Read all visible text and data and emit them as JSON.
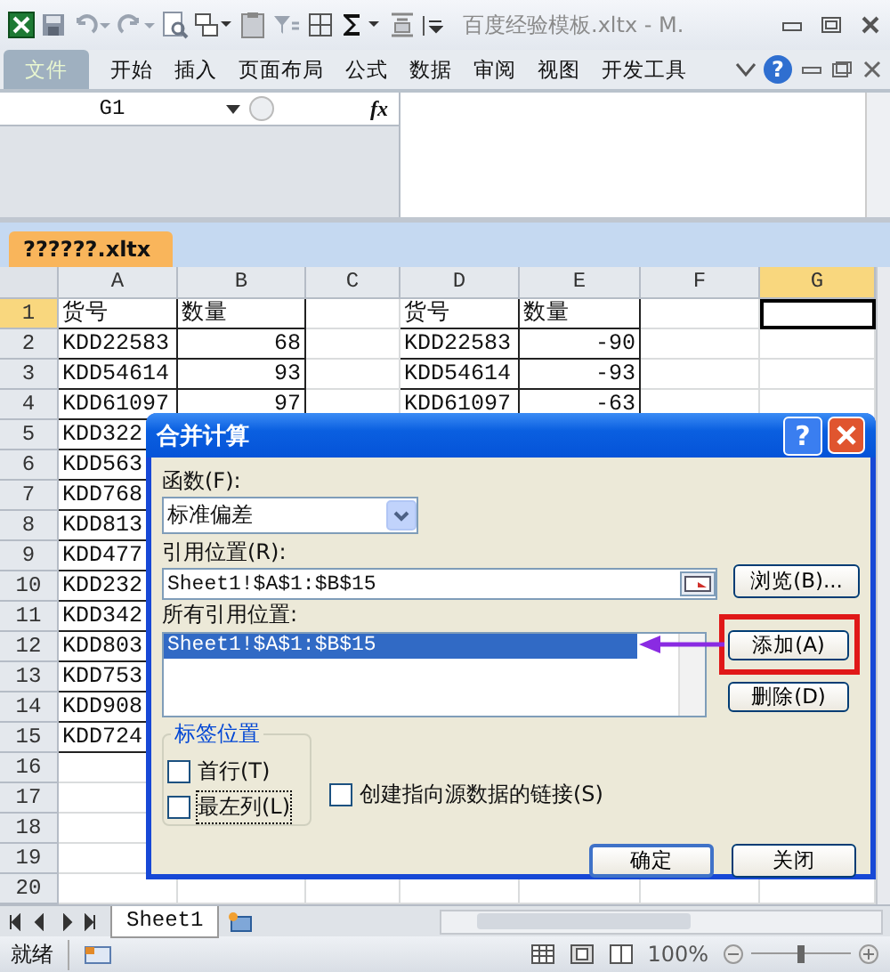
{
  "title_bar": {
    "title": "百度经验模板.xltx - M."
  },
  "ribbon_tabs": [
    {
      "label": "文件",
      "selected": true
    },
    {
      "label": "开始",
      "selected": false
    },
    {
      "label": "插入",
      "selected": false
    },
    {
      "label": "页面布局",
      "selected": false
    },
    {
      "label": "公式",
      "selected": false
    },
    {
      "label": "数据",
      "selected": false
    },
    {
      "label": "审阅",
      "selected": false
    },
    {
      "label": "视图",
      "selected": false
    },
    {
      "label": "开发工具",
      "selected": false
    }
  ],
  "help_glyph": "?",
  "formula_bar": {
    "name_box": "G1",
    "fx": "fx"
  },
  "workbook_tab": "??????.xltx",
  "sheet": {
    "columns": [
      {
        "label": "A",
        "selected": false
      },
      {
        "label": "B",
        "selected": false
      },
      {
        "label": "C",
        "selected": false
      },
      {
        "label": "D",
        "selected": false
      },
      {
        "label": "E",
        "selected": false
      },
      {
        "label": "F",
        "selected": false
      },
      {
        "label": "G",
        "selected": true
      }
    ],
    "rows": [
      {
        "label": "1",
        "selected": true,
        "cells": [
          {
            "kind": "text",
            "value": "货号"
          },
          {
            "kind": "text",
            "value": "数量"
          },
          {
            "kind": "blank"
          },
          {
            "kind": "text",
            "value": "货号"
          },
          {
            "kind": "text",
            "value": "数量"
          },
          {
            "kind": "blank"
          },
          {
            "kind": "blank",
            "active": true
          }
        ]
      },
      {
        "label": "2",
        "selected": false,
        "cells": [
          {
            "kind": "text",
            "value": "KDD22583"
          },
          {
            "kind": "number",
            "value": "68"
          },
          {
            "kind": "blank"
          },
          {
            "kind": "text",
            "value": "KDD22583"
          },
          {
            "kind": "number",
            "value": "-90"
          }
        ]
      },
      {
        "label": "3",
        "selected": false,
        "cells": [
          {
            "kind": "text",
            "value": "KDD54614"
          },
          {
            "kind": "number",
            "value": "93"
          },
          {
            "kind": "blank"
          },
          {
            "kind": "text",
            "value": "KDD54614"
          },
          {
            "kind": "number",
            "value": "-93"
          }
        ]
      },
      {
        "label": "4",
        "selected": false,
        "cells": [
          {
            "kind": "text",
            "value": "KDD61097"
          },
          {
            "kind": "number",
            "value": "97"
          },
          {
            "kind": "blank"
          },
          {
            "kind": "text",
            "value": "KDD61097"
          },
          {
            "kind": "number",
            "value": "-63"
          }
        ]
      },
      {
        "label": "5",
        "selected": false,
        "cells": [
          {
            "kind": "text",
            "value": "KDD322"
          }
        ]
      },
      {
        "label": "6",
        "selected": false,
        "cells": [
          {
            "kind": "text",
            "value": "KDD563"
          }
        ]
      },
      {
        "label": "7",
        "selected": false,
        "cells": [
          {
            "kind": "text",
            "value": "KDD768"
          }
        ]
      },
      {
        "label": "8",
        "selected": false,
        "cells": [
          {
            "kind": "text",
            "value": "KDD813"
          }
        ]
      },
      {
        "label": "9",
        "selected": false,
        "cells": [
          {
            "kind": "text",
            "value": "KDD477"
          }
        ]
      },
      {
        "label": "10",
        "selected": false,
        "cells": [
          {
            "kind": "text",
            "value": "KDD232"
          }
        ]
      },
      {
        "label": "11",
        "selected": false,
        "cells": [
          {
            "kind": "text",
            "value": "KDD342"
          }
        ]
      },
      {
        "label": "12",
        "selected": false,
        "cells": [
          {
            "kind": "text",
            "value": "KDD803"
          }
        ]
      },
      {
        "label": "13",
        "selected": false,
        "cells": [
          {
            "kind": "text",
            "value": "KDD753"
          }
        ]
      },
      {
        "label": "14",
        "selected": false,
        "cells": [
          {
            "kind": "text",
            "value": "KDD908"
          }
        ]
      },
      {
        "label": "15",
        "selected": false,
        "cells": [
          {
            "kind": "text",
            "value": "KDD724"
          }
        ]
      },
      {
        "label": "16",
        "selected": false
      },
      {
        "label": "17",
        "selected": false
      },
      {
        "label": "18",
        "selected": false
      },
      {
        "label": "19",
        "selected": false
      },
      {
        "label": "20",
        "selected": false
      }
    ]
  },
  "sheet_tabs": [
    {
      "label": "Sheet1",
      "selected": true
    }
  ],
  "status_bar": {
    "status": "就绪",
    "zoom": "100%",
    "zoom_slider": {
      "level": 0.5
    }
  },
  "dialog": {
    "title": "合并计算",
    "help_glyph": "?",
    "function_label": "函数(F):",
    "function_value": "标准偏差",
    "reference_label": "引用位置(R):",
    "reference_value": "Sheet1!$A$1:$B$15",
    "browse_button": "浏览(B)...",
    "all_references_label": "所有引用位置:",
    "all_references": [
      {
        "text": "Sheet1!$A$1:$B$15",
        "selected": true
      }
    ],
    "add_button": "添加(A)",
    "delete_button": "删除(D)",
    "label_group": {
      "title": "标签位置",
      "options": [
        {
          "label": "首行(T)",
          "checked": false
        },
        {
          "label": "最左列(L)",
          "checked": false
        }
      ]
    },
    "link_option": {
      "label": "创建指向源数据的链接(S)",
      "checked": false
    },
    "ok_button": "确定",
    "close_button": "关闭"
  }
}
